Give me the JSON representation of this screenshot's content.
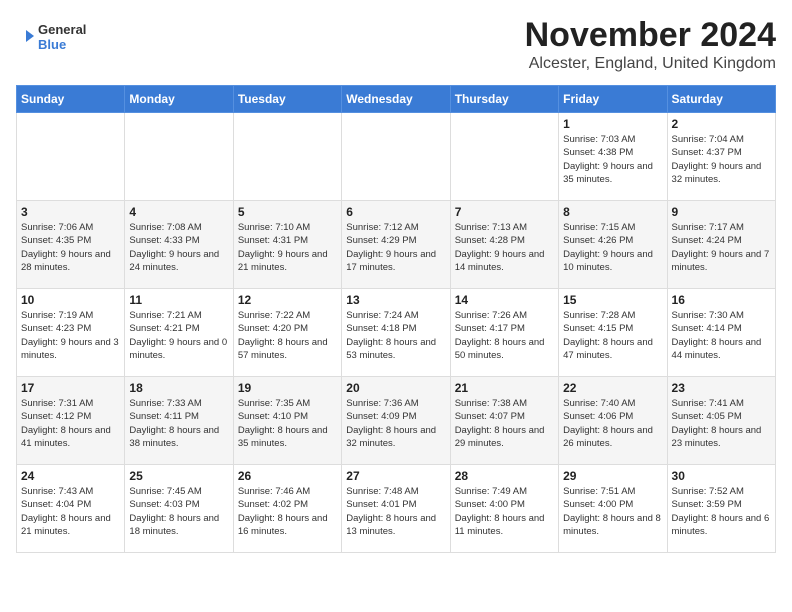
{
  "header": {
    "logo": {
      "text_general": "General",
      "text_blue": "Blue"
    },
    "title": "November 2024",
    "location": "Alcester, England, United Kingdom"
  },
  "calendar": {
    "days_of_week": [
      "Sunday",
      "Monday",
      "Tuesday",
      "Wednesday",
      "Thursday",
      "Friday",
      "Saturday"
    ],
    "weeks": [
      {
        "days": [
          {
            "num": "",
            "info": ""
          },
          {
            "num": "",
            "info": ""
          },
          {
            "num": "",
            "info": ""
          },
          {
            "num": "",
            "info": ""
          },
          {
            "num": "",
            "info": ""
          },
          {
            "num": "1",
            "info": "Sunrise: 7:03 AM\nSunset: 4:38 PM\nDaylight: 9 hours\nand 35 minutes."
          },
          {
            "num": "2",
            "info": "Sunrise: 7:04 AM\nSunset: 4:37 PM\nDaylight: 9 hours\nand 32 minutes."
          }
        ]
      },
      {
        "days": [
          {
            "num": "3",
            "info": "Sunrise: 7:06 AM\nSunset: 4:35 PM\nDaylight: 9 hours\nand 28 minutes."
          },
          {
            "num": "4",
            "info": "Sunrise: 7:08 AM\nSunset: 4:33 PM\nDaylight: 9 hours\nand 24 minutes."
          },
          {
            "num": "5",
            "info": "Sunrise: 7:10 AM\nSunset: 4:31 PM\nDaylight: 9 hours\nand 21 minutes."
          },
          {
            "num": "6",
            "info": "Sunrise: 7:12 AM\nSunset: 4:29 PM\nDaylight: 9 hours\nand 17 minutes."
          },
          {
            "num": "7",
            "info": "Sunrise: 7:13 AM\nSunset: 4:28 PM\nDaylight: 9 hours\nand 14 minutes."
          },
          {
            "num": "8",
            "info": "Sunrise: 7:15 AM\nSunset: 4:26 PM\nDaylight: 9 hours\nand 10 minutes."
          },
          {
            "num": "9",
            "info": "Sunrise: 7:17 AM\nSunset: 4:24 PM\nDaylight: 9 hours\nand 7 minutes."
          }
        ]
      },
      {
        "days": [
          {
            "num": "10",
            "info": "Sunrise: 7:19 AM\nSunset: 4:23 PM\nDaylight: 9 hours\nand 3 minutes."
          },
          {
            "num": "11",
            "info": "Sunrise: 7:21 AM\nSunset: 4:21 PM\nDaylight: 9 hours\nand 0 minutes."
          },
          {
            "num": "12",
            "info": "Sunrise: 7:22 AM\nSunset: 4:20 PM\nDaylight: 8 hours\nand 57 minutes."
          },
          {
            "num": "13",
            "info": "Sunrise: 7:24 AM\nSunset: 4:18 PM\nDaylight: 8 hours\nand 53 minutes."
          },
          {
            "num": "14",
            "info": "Sunrise: 7:26 AM\nSunset: 4:17 PM\nDaylight: 8 hours\nand 50 minutes."
          },
          {
            "num": "15",
            "info": "Sunrise: 7:28 AM\nSunset: 4:15 PM\nDaylight: 8 hours\nand 47 minutes."
          },
          {
            "num": "16",
            "info": "Sunrise: 7:30 AM\nSunset: 4:14 PM\nDaylight: 8 hours\nand 44 minutes."
          }
        ]
      },
      {
        "days": [
          {
            "num": "17",
            "info": "Sunrise: 7:31 AM\nSunset: 4:12 PM\nDaylight: 8 hours\nand 41 minutes."
          },
          {
            "num": "18",
            "info": "Sunrise: 7:33 AM\nSunset: 4:11 PM\nDaylight: 8 hours\nand 38 minutes."
          },
          {
            "num": "19",
            "info": "Sunrise: 7:35 AM\nSunset: 4:10 PM\nDaylight: 8 hours\nand 35 minutes."
          },
          {
            "num": "20",
            "info": "Sunrise: 7:36 AM\nSunset: 4:09 PM\nDaylight: 8 hours\nand 32 minutes."
          },
          {
            "num": "21",
            "info": "Sunrise: 7:38 AM\nSunset: 4:07 PM\nDaylight: 8 hours\nand 29 minutes."
          },
          {
            "num": "22",
            "info": "Sunrise: 7:40 AM\nSunset: 4:06 PM\nDaylight: 8 hours\nand 26 minutes."
          },
          {
            "num": "23",
            "info": "Sunrise: 7:41 AM\nSunset: 4:05 PM\nDaylight: 8 hours\nand 23 minutes."
          }
        ]
      },
      {
        "days": [
          {
            "num": "24",
            "info": "Sunrise: 7:43 AM\nSunset: 4:04 PM\nDaylight: 8 hours\nand 21 minutes."
          },
          {
            "num": "25",
            "info": "Sunrise: 7:45 AM\nSunset: 4:03 PM\nDaylight: 8 hours\nand 18 minutes."
          },
          {
            "num": "26",
            "info": "Sunrise: 7:46 AM\nSunset: 4:02 PM\nDaylight: 8 hours\nand 16 minutes."
          },
          {
            "num": "27",
            "info": "Sunrise: 7:48 AM\nSunset: 4:01 PM\nDaylight: 8 hours\nand 13 minutes."
          },
          {
            "num": "28",
            "info": "Sunrise: 7:49 AM\nSunset: 4:00 PM\nDaylight: 8 hours\nand 11 minutes."
          },
          {
            "num": "29",
            "info": "Sunrise: 7:51 AM\nSunset: 4:00 PM\nDaylight: 8 hours\nand 8 minutes."
          },
          {
            "num": "30",
            "info": "Sunrise: 7:52 AM\nSunset: 3:59 PM\nDaylight: 8 hours\nand 6 minutes."
          }
        ]
      }
    ]
  }
}
